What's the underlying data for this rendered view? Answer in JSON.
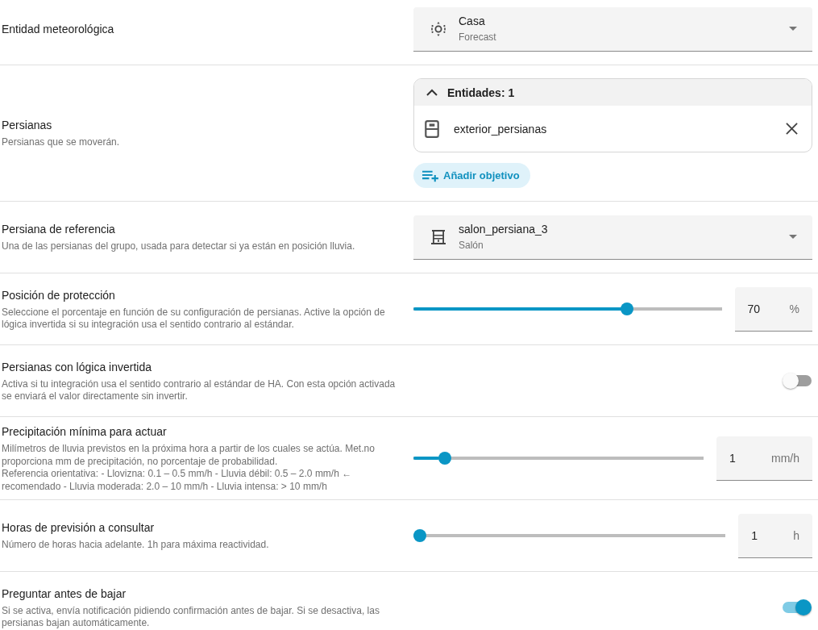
{
  "rows": [
    {
      "label": "Entidad meteorológica",
      "control": {
        "kind": "weather_select",
        "value": "Casa",
        "secondary": "Forecast"
      }
    },
    {
      "label": "Persianas",
      "description": "Persianas que se moverán.",
      "control": {
        "kind": "entity_list",
        "header": "Entidades: 1",
        "expanded": true,
        "items": [
          {
            "name": "exterior_persianas"
          }
        ],
        "add_button": "Añadir objetivo"
      }
    },
    {
      "label": "Persiana de referencia",
      "description": "Una de las persianas del grupo, usada para detectar si ya están en posición lluvia.",
      "control": {
        "kind": "cover_select",
        "value": "salon_persiana_3",
        "secondary": "Salón"
      }
    },
    {
      "label": "Posición de protección",
      "description": "Seleccione el porcentaje en función de su configuración de persianas. Active la opción de lógica invertida si su integración usa el sentido contrario al estándar.",
      "control": {
        "kind": "slider",
        "level": 0.7,
        "value": "70",
        "unit": "%"
      }
    },
    {
      "label": "Persianas con lógica invertida",
      "description": "Activa si tu integración usa el sentido contrario al estándar de HA. Con esta opción activada se enviará el valor directamente sin invertir.",
      "control": {
        "kind": "toggle",
        "on": false
      }
    },
    {
      "label": "Precipitación mínima para actuar",
      "description": "Milímetros de lluvia previstos en la próxima hora a partir de los cuales se actúa. Met.no proporciona mm de precipitación, no porcentaje de probabilidad.\nReferencia orientativa: - Llovizna: 0.1 – 0.5 mm/h - Lluvia débil: 0.5 – 2.0 mm/h ← recomendado - Lluvia moderada: 2.0 – 10 mm/h - Lluvia intensa: > 10 mm/h",
      "control": {
        "kind": "slider",
        "level": 0.09,
        "value": "1",
        "unit": "mm/h"
      }
    },
    {
      "label": "Horas de previsión a consultar",
      "description": "Número de horas hacia adelante. 1h para máxima reactividad.",
      "control": {
        "kind": "slider",
        "level": 0,
        "value": "1",
        "unit": "h"
      }
    },
    {
      "label": "Preguntar antes de bajar",
      "description": "Si se activa, envía notificación pidiendo confirmación antes de bajar. Si se desactiva, las persianas bajan automáticamente.",
      "control": {
        "kind": "toggle",
        "on": true
      }
    }
  ]
}
